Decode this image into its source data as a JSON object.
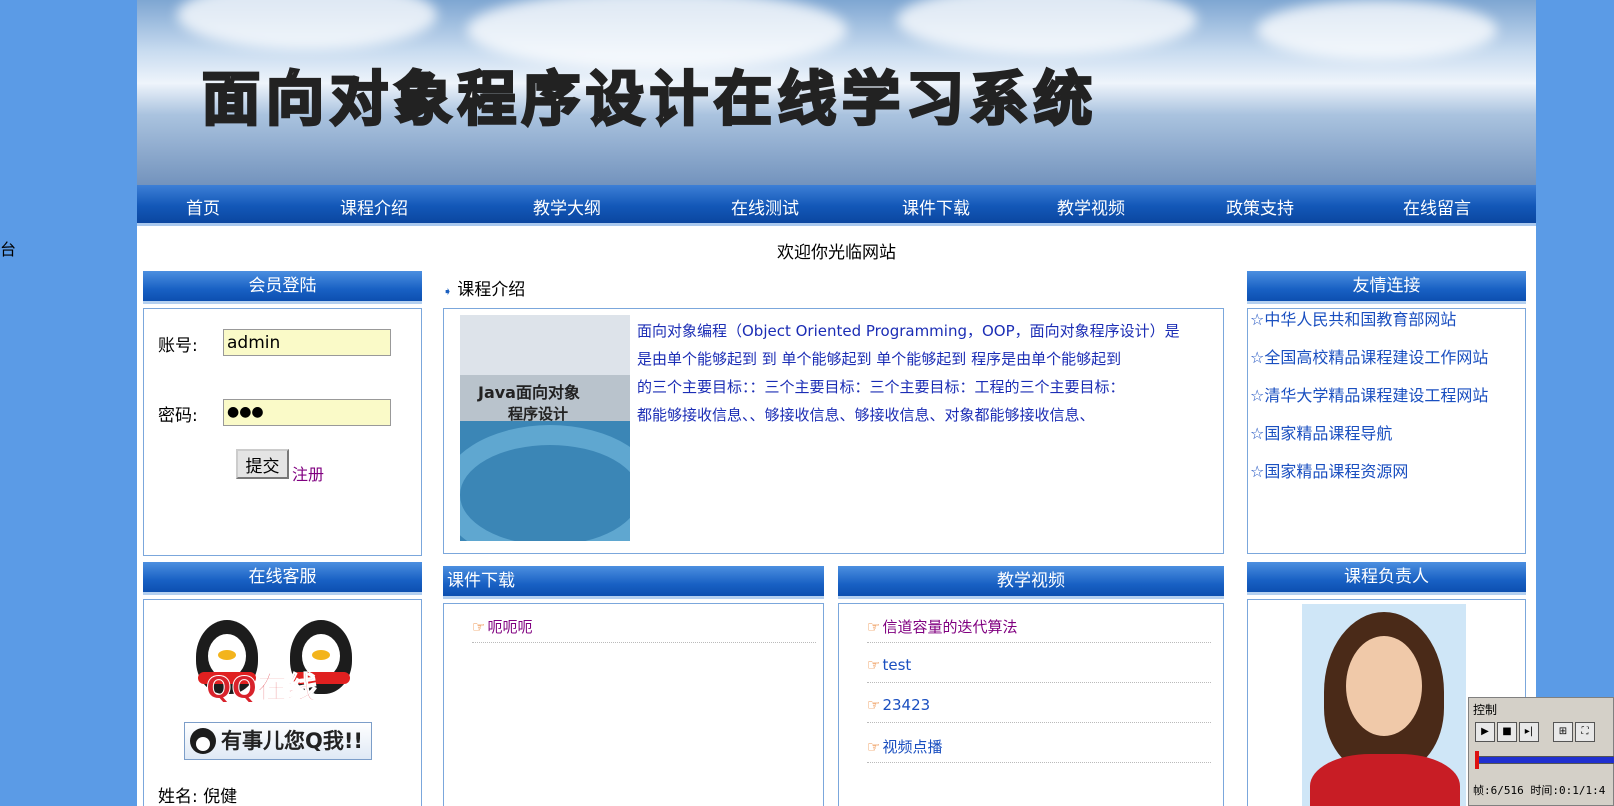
{
  "stray_glyph": "台",
  "header": {
    "title": "面向对象程序设计在线学习系统",
    "nav": [
      "首页",
      "课程介绍",
      "教学大纲",
      "在线测试",
      "课件下载",
      "教学视频",
      "政策支持",
      "在线留言"
    ]
  },
  "welcome": "欢迎你光临网站",
  "login": {
    "title": "会员登陆",
    "account_label": "账号:",
    "account_value": "admin",
    "password_label": "密码:",
    "password_value": "●●●",
    "submit": "提交",
    "register": "注册"
  },
  "course_intro": {
    "title": "课程介绍",
    "book_title_1": "Java面向对象",
    "book_title_2": "程序设计",
    "lines": [
      "面向对象编程（Object Oriented Programming，OOP，面向对象程序设计）是",
      "是由单个能够起到 到 单个能够起到 单个能够起到 程序是由单个能够起到",
      "的三个主要目标：：三个主要目标：三个主要目标：工程的三个主要目标：",
      "都能够接收信息、、够接收信息、够接收信息、对象都能够接收信息、"
    ]
  },
  "friend_links": {
    "title": "友情连接",
    "items": [
      "☆中华人民共和国教育部网站",
      "☆全国高校精品课程建设工作网站",
      "☆清华大学精品课程建设工程网站",
      "☆国家精品课程导航",
      "☆国家精品课程资源网"
    ]
  },
  "customer_service": {
    "title": "在线客服",
    "qq_online": "QQ在线",
    "qq_button": "有事儿您Q我!!",
    "name": "姓名: 倪健"
  },
  "downloads": {
    "title": "课件下载",
    "items": [
      "呃呃呃"
    ]
  },
  "videos": {
    "title": "教学视频",
    "items": [
      "信道容量的迭代算法",
      "test",
      "23423",
      "视频点播"
    ]
  },
  "course_owner": {
    "title": "课程负责人"
  },
  "control_panel": {
    "title": "控制",
    "status": "帧:6/516 时间:0:1/1:4"
  },
  "colors": {
    "nav_blue": "#1358b8",
    "link_blue": "#1a4fc0",
    "visited_purple": "#800080",
    "page_bg": "#5b9be6"
  }
}
